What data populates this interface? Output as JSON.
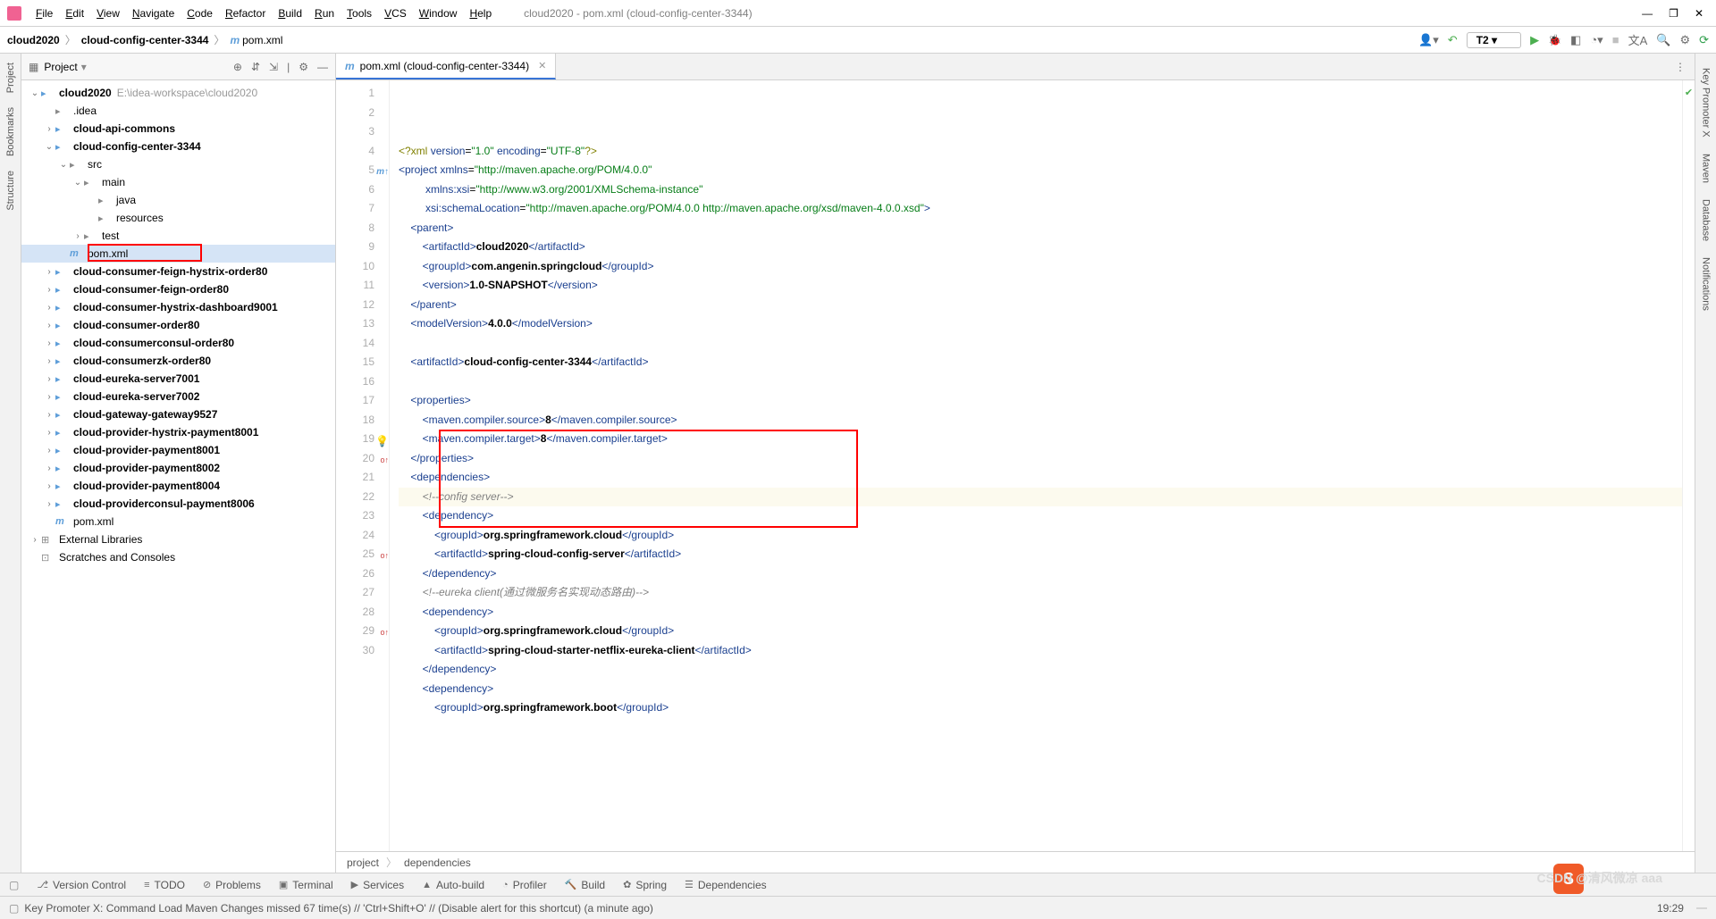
{
  "window": {
    "title": "cloud2020 - pom.xml (cloud-config-center-3344)",
    "minimize": "—",
    "maximize": "❐",
    "close": "✕"
  },
  "menu": [
    "File",
    "Edit",
    "View",
    "Navigate",
    "Code",
    "Refactor",
    "Build",
    "Run",
    "Tools",
    "VCS",
    "Window",
    "Help"
  ],
  "breadcrumb": [
    "cloud2020",
    "cloud-config-center-3344",
    "pom.xml"
  ],
  "runconfig": "T2",
  "project": {
    "label": "Project",
    "root_name": "cloud2020",
    "root_path": "E:\\idea-workspace\\cloud2020",
    "nodes": [
      {
        "d": 1,
        "t": "dir",
        "n": ".idea"
      },
      {
        "d": 1,
        "t": "mod",
        "n": "cloud-api-commons",
        "arr": ">"
      },
      {
        "d": 1,
        "t": "mod",
        "n": "cloud-config-center-3344",
        "arr": "v"
      },
      {
        "d": 2,
        "t": "dir",
        "n": "src",
        "arr": "v"
      },
      {
        "d": 3,
        "t": "dir",
        "n": "main",
        "arr": "v"
      },
      {
        "d": 4,
        "t": "dir",
        "n": "java"
      },
      {
        "d": 4,
        "t": "dir",
        "n": "resources"
      },
      {
        "d": 3,
        "t": "dir",
        "n": "test",
        "arr": ">"
      },
      {
        "d": 2,
        "t": "pom",
        "n": "pom.xml",
        "sel": true,
        "box": true
      },
      {
        "d": 1,
        "t": "mod",
        "n": "cloud-consumer-feign-hystrix-order80",
        "arr": ">"
      },
      {
        "d": 1,
        "t": "mod",
        "n": "cloud-consumer-feign-order80",
        "arr": ">"
      },
      {
        "d": 1,
        "t": "mod",
        "n": "cloud-consumer-hystrix-dashboard9001",
        "arr": ">"
      },
      {
        "d": 1,
        "t": "mod",
        "n": "cloud-consumer-order80",
        "arr": ">"
      },
      {
        "d": 1,
        "t": "mod",
        "n": "cloud-consumerconsul-order80",
        "arr": ">"
      },
      {
        "d": 1,
        "t": "mod",
        "n": "cloud-consumerzk-order80",
        "arr": ">"
      },
      {
        "d": 1,
        "t": "mod",
        "n": "cloud-eureka-server7001",
        "arr": ">"
      },
      {
        "d": 1,
        "t": "mod",
        "n": "cloud-eureka-server7002",
        "arr": ">"
      },
      {
        "d": 1,
        "t": "mod",
        "n": "cloud-gateway-gateway9527",
        "arr": ">"
      },
      {
        "d": 1,
        "t": "mod",
        "n": "cloud-provider-hystrix-payment8001",
        "arr": ">"
      },
      {
        "d": 1,
        "t": "mod",
        "n": "cloud-provider-payment8001",
        "arr": ">"
      },
      {
        "d": 1,
        "t": "mod",
        "n": "cloud-provider-payment8002",
        "arr": ">"
      },
      {
        "d": 1,
        "t": "mod",
        "n": "cloud-provider-payment8004",
        "arr": ">"
      },
      {
        "d": 1,
        "t": "mod",
        "n": "cloud-providerconsul-payment8006",
        "arr": ">"
      },
      {
        "d": 1,
        "t": "pom",
        "n": "pom.xml"
      }
    ],
    "ext_lib": "External Libraries",
    "scratches": "Scratches and Consoles"
  },
  "tab": {
    "name": "pom.xml (cloud-config-center-3344)"
  },
  "code": {
    "lines": [
      {
        "n": 1,
        "html": "<span class='t-pi'>&lt;?xml</span> <span class='t-attr'>version</span>=<span class='t-str'>\"1.0\"</span> <span class='t-attr'>encoding</span>=<span class='t-str'>\"UTF-8\"</span><span class='t-pi'>?&gt;</span>"
      },
      {
        "n": 2,
        "html": "<span class='t-tag'>&lt;project</span> <span class='t-attr'>xmlns</span>=<span class='t-str'>\"http://maven.apache.org/POM/4.0.0\"</span>"
      },
      {
        "n": 3,
        "html": "         <span class='t-attr'>xmlns:xsi</span>=<span class='t-str'>\"http://www.w3.org/2001/XMLSchema-instance\"</span>"
      },
      {
        "n": 4,
        "html": "         <span class='t-attr'>xsi:schemaLocation</span>=<span class='t-str'>\"http://maven.apache.org/POM/4.0.0 http://maven.apache.org/xsd/maven-4.0.0.xsd\"</span><span class='t-tag'>&gt;</span>"
      },
      {
        "n": 5,
        "html": "    <span class='t-tag'>&lt;parent&gt;</span>",
        "gut": "m↑"
      },
      {
        "n": 6,
        "html": "        <span class='t-tag'>&lt;artifactId&gt;</span><span class='t-txt'>cloud2020</span><span class='t-tag'>&lt;/artifactId&gt;</span>"
      },
      {
        "n": 7,
        "html": "        <span class='t-tag'>&lt;groupId&gt;</span><span class='t-txt'>com.angenin.springcloud</span><span class='t-tag'>&lt;/groupId&gt;</span>"
      },
      {
        "n": 8,
        "html": "        <span class='t-tag'>&lt;version&gt;</span><span class='t-txt'>1.0-SNAPSHOT</span><span class='t-tag'>&lt;/version&gt;</span>"
      },
      {
        "n": 9,
        "html": "    <span class='t-tag'>&lt;/parent&gt;</span>"
      },
      {
        "n": 10,
        "html": "    <span class='t-tag'>&lt;modelVersion&gt;</span><span class='t-txt'>4.0.0</span><span class='t-tag'>&lt;/modelVersion&gt;</span>"
      },
      {
        "n": 11,
        "html": ""
      },
      {
        "n": 12,
        "html": "    <span class='t-tag'>&lt;artifactId&gt;</span><span class='t-txt'>cloud-config-center-3344</span><span class='t-tag'>&lt;/artifactId&gt;</span>"
      },
      {
        "n": 13,
        "html": ""
      },
      {
        "n": 14,
        "html": "    <span class='t-tag'>&lt;properties&gt;</span>"
      },
      {
        "n": 15,
        "html": "        <span class='t-tag'>&lt;maven.compiler.source&gt;</span><span class='t-txt'>8</span><span class='t-tag'>&lt;/maven.compiler.source&gt;</span>"
      },
      {
        "n": 16,
        "html": "        <span class='t-tag'>&lt;maven.compiler.target&gt;</span><span class='t-txt'>8</span><span class='t-tag'>&lt;/maven.compiler.target&gt;</span>"
      },
      {
        "n": 17,
        "html": "    <span class='t-tag'>&lt;/properties&gt;</span>"
      },
      {
        "n": 18,
        "html": "    <span class='t-tag'>&lt;dependencies&gt;</span>"
      },
      {
        "n": 19,
        "html": "        <span class='t-cmt'>&lt;!--config server--&gt;</span>",
        "hl": true,
        "bulb": true
      },
      {
        "n": 20,
        "html": "        <span class='t-tag'>&lt;dependency&gt;</span>",
        "gut": "o↑"
      },
      {
        "n": 21,
        "html": "            <span class='t-tag'>&lt;groupId&gt;</span><span class='t-txt'>org.springframework.cloud</span><span class='t-tag'>&lt;/groupId&gt;</span>"
      },
      {
        "n": 22,
        "html": "            <span class='t-tag'>&lt;artifactId&gt;</span><span class='t-txt'>spring-cloud-config-server</span><span class='t-tag'>&lt;/artifactId&gt;</span>"
      },
      {
        "n": 23,
        "html": "        <span class='t-tag'>&lt;/dependency&gt;</span>"
      },
      {
        "n": 24,
        "html": "        <span class='t-cmt'>&lt;!--eureka client(通过微服务名实现动态路由)--&gt;</span>"
      },
      {
        "n": 25,
        "html": "        <span class='t-tag'>&lt;dependency&gt;</span>",
        "gut": "o↑"
      },
      {
        "n": 26,
        "html": "            <span class='t-tag'>&lt;groupId&gt;</span><span class='t-txt'>org.springframework.cloud</span><span class='t-tag'>&lt;/groupId&gt;</span>"
      },
      {
        "n": 27,
        "html": "            <span class='t-tag'>&lt;artifactId&gt;</span><span class='t-txt'>spring-cloud-starter-netflix-eureka-client</span><span class='t-tag'>&lt;/artifactId&gt;</span>"
      },
      {
        "n": 28,
        "html": "        <span class='t-tag'>&lt;/dependency&gt;</span>"
      },
      {
        "n": 29,
        "html": "        <span class='t-tag'>&lt;dependency&gt;</span>",
        "gut": "o↑"
      },
      {
        "n": 30,
        "html": "            <span class='t-tag'>&lt;groupId&gt;</span><span class='t-txt'>org.springframework.boot</span><span class='t-tag'>&lt;/groupId&gt;</span>"
      }
    ]
  },
  "crumbs": [
    "project",
    "dependencies"
  ],
  "bottom_tools": [
    {
      "ic": "⎇",
      "l": "Version Control"
    },
    {
      "ic": "≡",
      "l": "TODO"
    },
    {
      "ic": "⊘",
      "l": "Problems"
    },
    {
      "ic": "▣",
      "l": "Terminal"
    },
    {
      "ic": "▶",
      "l": "Services"
    },
    {
      "ic": "▲",
      "l": "Auto-build"
    },
    {
      "ic": "◔",
      "l": "Profiler"
    },
    {
      "ic": "🔨",
      "l": "Build"
    },
    {
      "ic": "✿",
      "l": "Spring"
    },
    {
      "ic": "☰",
      "l": "Dependencies"
    }
  ],
  "status": {
    "msg": "Key Promoter X: Command Load Maven Changes missed 67 time(s) // 'Ctrl+Shift+O' // (Disable alert for this shortcut) (a minute ago)",
    "time": "19:29"
  },
  "right_tools": [
    "Key Promoter X",
    "Maven",
    "Database",
    "Notifications"
  ],
  "left_tools": [
    "Project",
    "Bookmarks",
    "Structure"
  ]
}
